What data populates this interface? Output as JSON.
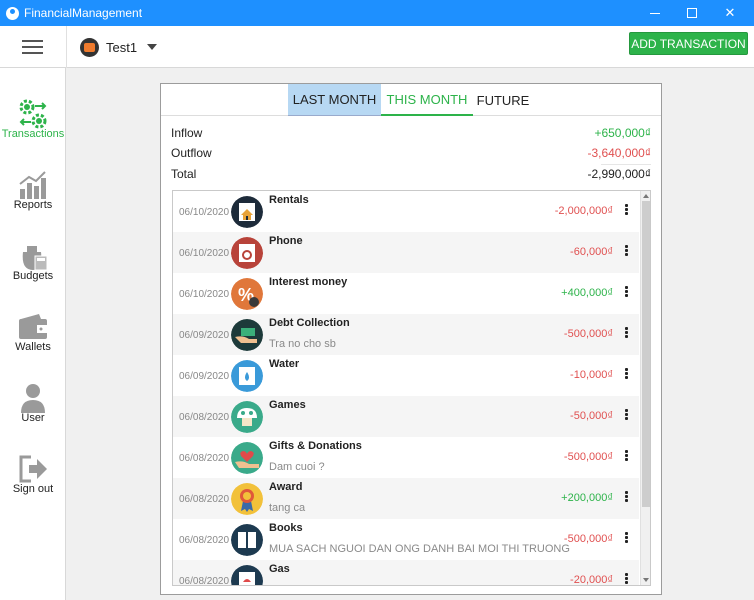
{
  "window": {
    "title": "FinancialManagement"
  },
  "topbar": {
    "wallet_name": "Test1",
    "add_button": "ADD TRANSACTION"
  },
  "sidebar": {
    "items": [
      {
        "label": "Transactions",
        "icon": "transactions-icon",
        "active": true
      },
      {
        "label": "Reports",
        "icon": "reports-icon"
      },
      {
        "label": "Budgets",
        "icon": "budgets-icon"
      },
      {
        "label": "Wallets",
        "icon": "wallets-icon"
      },
      {
        "label": "User",
        "icon": "user-icon"
      },
      {
        "label": "Sign out",
        "icon": "sign-out-icon"
      }
    ]
  },
  "tabs": {
    "last": "LAST MONTH",
    "this": "THIS MONTH",
    "future": "FUTURE",
    "active": "this"
  },
  "summary": {
    "inflow_label": "Inflow",
    "inflow_value": "+650,000₫",
    "outflow_label": "Outflow",
    "outflow_value": "-3,640,000₫",
    "total_label": "Total",
    "total_value": "-2,990,000₫"
  },
  "colors": {
    "accent": "#2db34a",
    "negative": "#e05050",
    "titlebar": "#1e90ff",
    "tab_selected_bg": "#b7d8f3"
  },
  "transactions": [
    {
      "date": "06/10/2020",
      "name": "Rentals",
      "note": "",
      "amount": "-2,000,000₫",
      "type": "neg",
      "icon": "house-icon"
    },
    {
      "date": "06/10/2020",
      "name": "Phone",
      "note": "",
      "amount": "-60,000₫",
      "type": "neg",
      "icon": "phone-icon"
    },
    {
      "date": "06/10/2020",
      "name": "Interest money",
      "note": "",
      "amount": "+400,000₫",
      "type": "pos",
      "icon": "percent-icon"
    },
    {
      "date": "06/09/2020",
      "name": "Debt Collection",
      "note": "Tra no cho sb",
      "amount": "-500,000₫",
      "type": "neg",
      "icon": "money-hand-icon"
    },
    {
      "date": "06/09/2020",
      "name": "Water",
      "note": "",
      "amount": "-10,000₫",
      "type": "neg",
      "icon": "water-drop-icon"
    },
    {
      "date": "06/08/2020",
      "name": "Games",
      "note": "",
      "amount": "-50,000₫",
      "type": "neg",
      "icon": "mushroom-icon"
    },
    {
      "date": "06/08/2020",
      "name": "Gifts & Donations",
      "note": "Dam cuoi ?",
      "amount": "-500,000₫",
      "type": "neg",
      "icon": "heart-hand-icon"
    },
    {
      "date": "06/08/2020",
      "name": "Award",
      "note": "tang ca",
      "amount": "+200,000₫",
      "type": "pos",
      "icon": "medal-icon"
    },
    {
      "date": "06/08/2020",
      "name": "Books",
      "note": "MUA SACH NGUOI DAN ONG DANH BAI MOI THI TRUONG",
      "amount": "-500,000₫",
      "type": "neg",
      "icon": "book-icon"
    },
    {
      "date": "06/08/2020",
      "name": "Gas",
      "note": "",
      "amount": "-20,000₫",
      "type": "neg",
      "icon": "gas-icon"
    }
  ]
}
